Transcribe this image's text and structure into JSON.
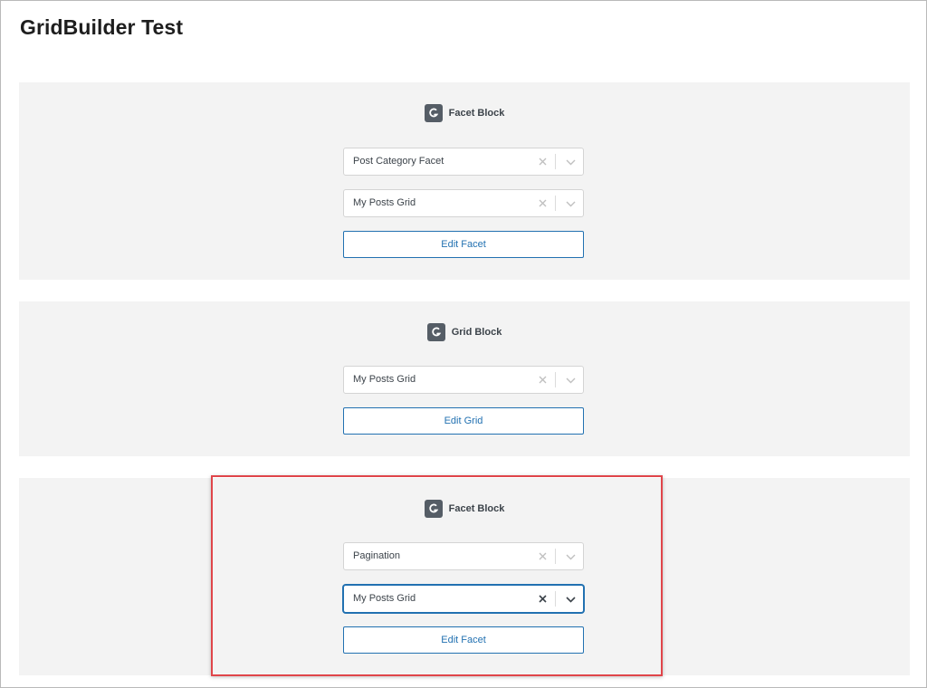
{
  "page": {
    "title": "GridBuilder Test"
  },
  "blocks": [
    {
      "title": "Facet Block",
      "icon": "gridbuilder-logo-icon",
      "selects": [
        {
          "value": "Post Category Facet",
          "focused": false
        },
        {
          "value": "My Posts Grid",
          "focused": false
        }
      ],
      "button": "Edit Facet"
    },
    {
      "title": "Grid Block",
      "icon": "gridbuilder-logo-icon",
      "selects": [
        {
          "value": "My Posts Grid",
          "focused": false
        }
      ],
      "button": "Edit Grid"
    },
    {
      "title": "Facet Block",
      "icon": "gridbuilder-logo-icon",
      "selects": [
        {
          "value": "Pagination",
          "focused": false
        },
        {
          "value": "My Posts Grid",
          "focused": true
        }
      ],
      "button": "Edit Facet"
    }
  ],
  "annotation": {
    "highlight_color": "#e0454a",
    "highlighted_block": 2
  },
  "colors": {
    "accent": "#2271b1",
    "block_bg": "#f3f3f3",
    "icon_bg": "#555d66",
    "text": "#3c434a"
  },
  "icons": {
    "clear": "close-icon",
    "dropdown": "chevron-down-icon"
  }
}
